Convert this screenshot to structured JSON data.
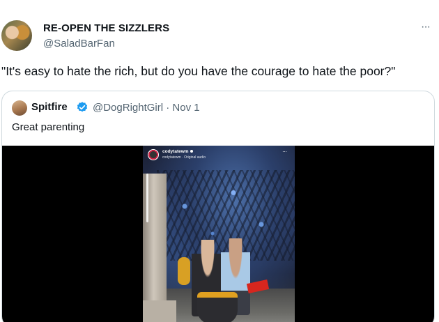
{
  "tweet": {
    "display_name": "RE-OPEN THE SIZZLERS",
    "handle": "@SaladBarFan",
    "more_label": "···",
    "text": "\"It's easy to hate the rich, but do you have the courage to hate the poor?\""
  },
  "quote": {
    "display_name": "Spitfire",
    "handle_date": "@DogRightGirl · Nov 1",
    "text": "Great parenting",
    "verified_color": "#1d9bf0"
  },
  "video": {
    "username": "codytatewm",
    "audio": "codytatewm · Original audio",
    "more_label": "···"
  },
  "icons": [
    "avatar",
    "more-icon",
    "verified-badge-icon",
    "ig-avatar",
    "ig-more-icon"
  ]
}
